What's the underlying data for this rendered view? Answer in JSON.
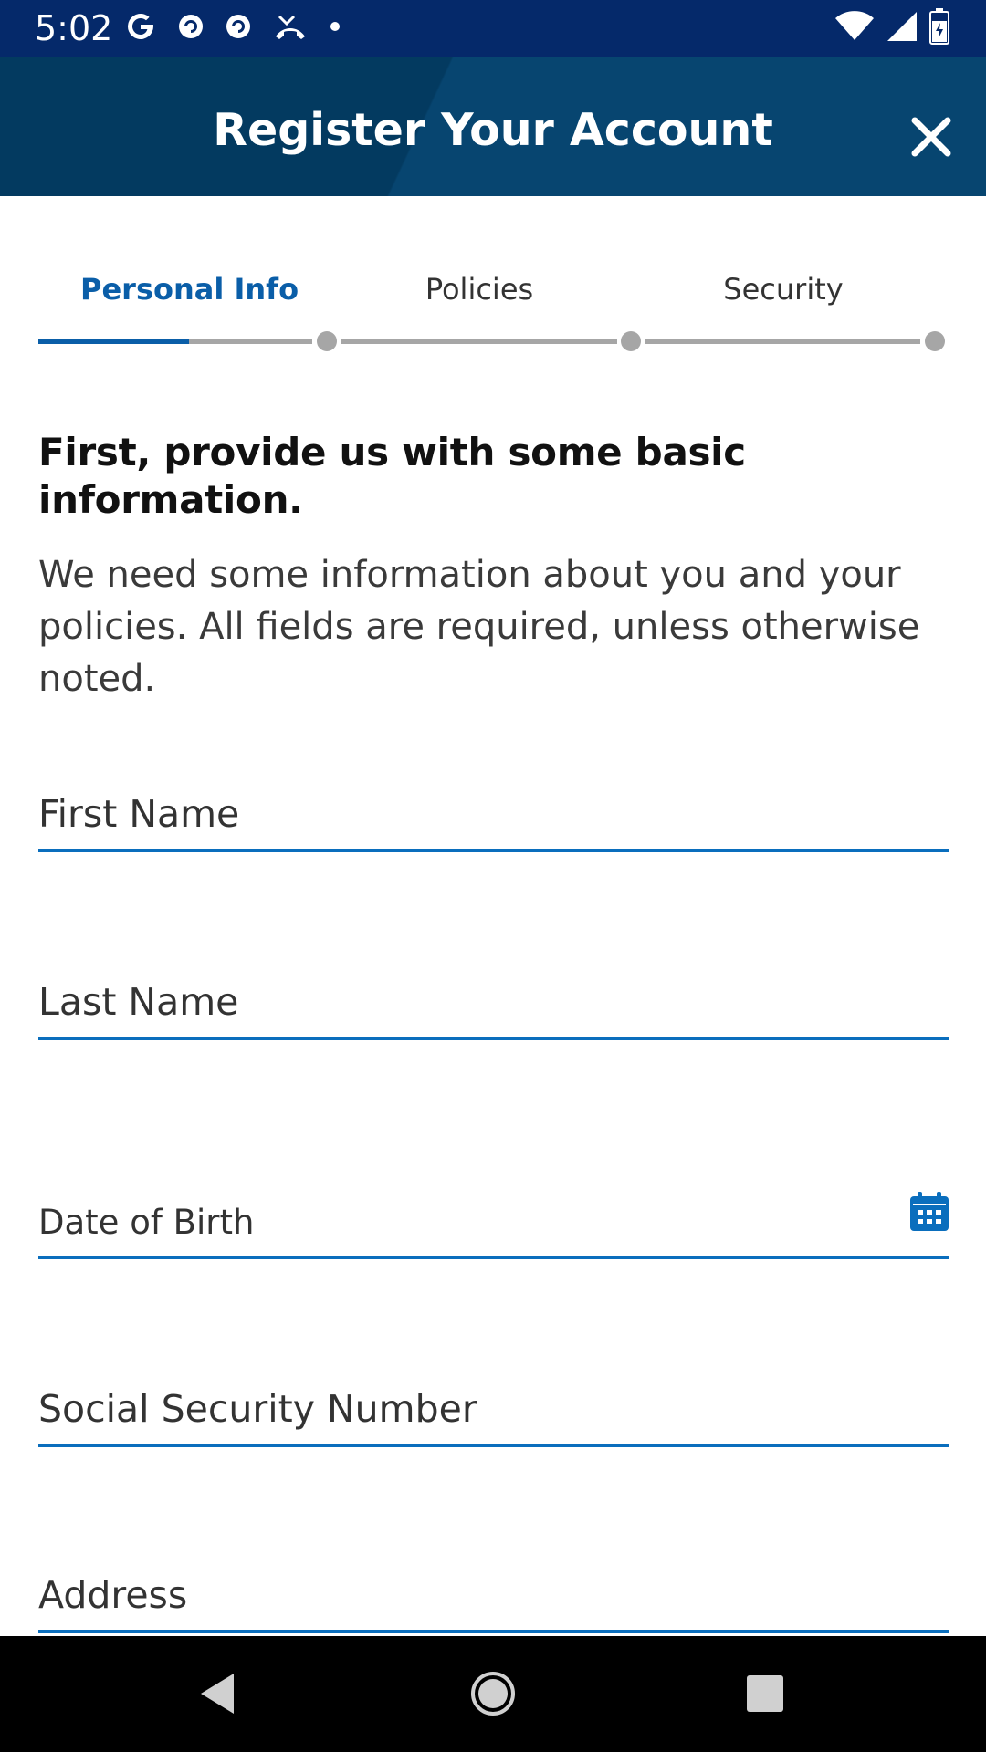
{
  "status_bar": {
    "time": "5:02",
    "left_icons": [
      "google-g-icon",
      "pocket-casts-icon",
      "pocket-casts-icon",
      "missed-call-icon",
      "notification-dot-icon"
    ],
    "right_icons": [
      "wifi-icon",
      "cell-signal-icon",
      "battery-icon"
    ]
  },
  "header": {
    "title": "Register Your Account",
    "close_icon": "close-icon"
  },
  "stepper": {
    "steps": [
      {
        "label": "Personal Info",
        "active": true
      },
      {
        "label": "Policies",
        "active": false
      },
      {
        "label": "Security",
        "active": false
      }
    ],
    "progress_fraction": 0.5,
    "accent_color": "#0a5ea8",
    "inactive_color": "#a6a6a6"
  },
  "intro": {
    "title": "First, provide us with some basic information.",
    "text": "We need some information about you and your policies. All fields are required, unless otherwise noted."
  },
  "form": {
    "fields": [
      {
        "placeholder": "First Name"
      },
      {
        "placeholder": "Last Name"
      },
      {
        "placeholder": "Date of Birth",
        "icon": "calendar-icon"
      },
      {
        "placeholder": "Social Security Number"
      },
      {
        "placeholder": "Address"
      }
    ],
    "underline_color": "#0a6ebd"
  },
  "nav_bar": {
    "buttons": [
      "back-icon",
      "home-icon",
      "recents-icon"
    ]
  }
}
